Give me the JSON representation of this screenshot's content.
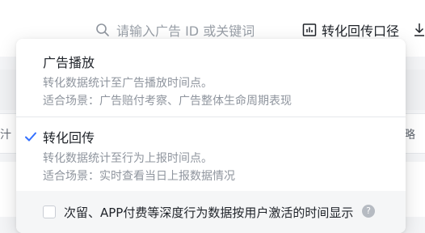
{
  "header": {
    "search_placeholder": "请输入广告 ID 或关键词",
    "conversion_button_label": "转化回传口径"
  },
  "background": {
    "left_peek": "汁",
    "right_peek": "略"
  },
  "dropdown": {
    "options": [
      {
        "title": "广告播放",
        "description": "转化数据统计至广告播放时间点。",
        "scenario": "适合场景：广告赔付考察、广告整体生命周期表现",
        "selected": false
      },
      {
        "title": "转化回传",
        "description": "转化数据统计至行为上报时间点。",
        "scenario": "适合场景：实时查看当日上报数据情况",
        "selected": true
      }
    ],
    "footer_checkbox": {
      "label": "次留、APP付费等深度行为数据按用户激活的时间显示",
      "checked": false,
      "help": "?"
    }
  },
  "colors": {
    "accent": "#3370ff",
    "text": "#1f2329",
    "muted": "#8f959e"
  }
}
